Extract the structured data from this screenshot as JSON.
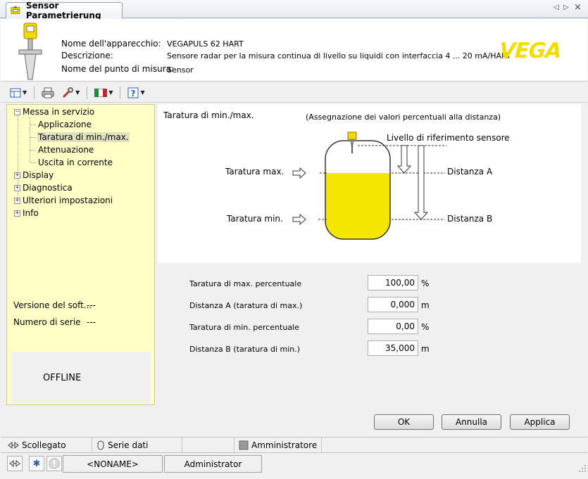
{
  "tab": {
    "title": "Sensor Parametrierung",
    "nav_left": "◁",
    "nav_right": "▷",
    "close": "×"
  },
  "header": {
    "device_name_label": "Nome dell'apparecchio:",
    "device_name_value": "VEGAPULS 62 HART",
    "description_label": "Descrizione:",
    "description_value": "Sensore radar per la misura continua di livello su liquidi con interfaccia 4 ... 20 mA/HART",
    "measure_point_label": "Nome del punto di misura:",
    "measure_point_value": "Sensor",
    "logo_text": "VEGA"
  },
  "toolbar": {
    "icons": [
      "view-icon",
      "print-icon",
      "tools-icon",
      "language-flag-icon",
      "help-icon"
    ]
  },
  "tree": {
    "items": [
      {
        "label": "Messa in servizio",
        "expander": "−"
      },
      {
        "label": "Applicazione"
      },
      {
        "label": "Taratura di min./max."
      },
      {
        "label": "Attenuazione"
      },
      {
        "label": "Uscita in corrente"
      },
      {
        "label": "Display",
        "expander": "+"
      },
      {
        "label": "Diagnostica",
        "expander": "+"
      },
      {
        "label": "Ulteriori impostazioni",
        "expander": "+"
      },
      {
        "label": "Info",
        "expander": "+"
      }
    ],
    "software_version_label": "Versione del soft...",
    "software_version_value": "---",
    "serial_label": "Numero di serie",
    "serial_value": "---",
    "status": "OFFLINE"
  },
  "diagram": {
    "title": "Taratura di min./max.",
    "subtitle": "(Assegnazione dei valori percentuali alla distanza)",
    "reference_label": "Livello di riferimento sensore",
    "max_label": "Taratura max.",
    "min_label": "Taratura min.",
    "distance_a_label": "Distanza A",
    "distance_b_label": "Distanza B",
    "fill_color": "#f5e600"
  },
  "form": {
    "rows": [
      {
        "label": "Taratura di max. percentuale",
        "value": "100,00",
        "unit": "%"
      },
      {
        "label": "Distanza A (taratura di max.)",
        "value": "0,000",
        "unit": "m"
      },
      {
        "label": "Taratura di min. percentuale",
        "value": "0,00",
        "unit": "%"
      },
      {
        "label": "Distanza B (taratura di min.)",
        "value": "35,000",
        "unit": "m"
      }
    ]
  },
  "buttons": {
    "ok": "OK",
    "cancel": "Annulla",
    "apply": "Applica"
  },
  "statusbar": {
    "connection": "Scollegato",
    "dataset": "Serie dati",
    "role": "Amministratore",
    "device_tag": "<NONAME>",
    "user": "Administrator"
  }
}
